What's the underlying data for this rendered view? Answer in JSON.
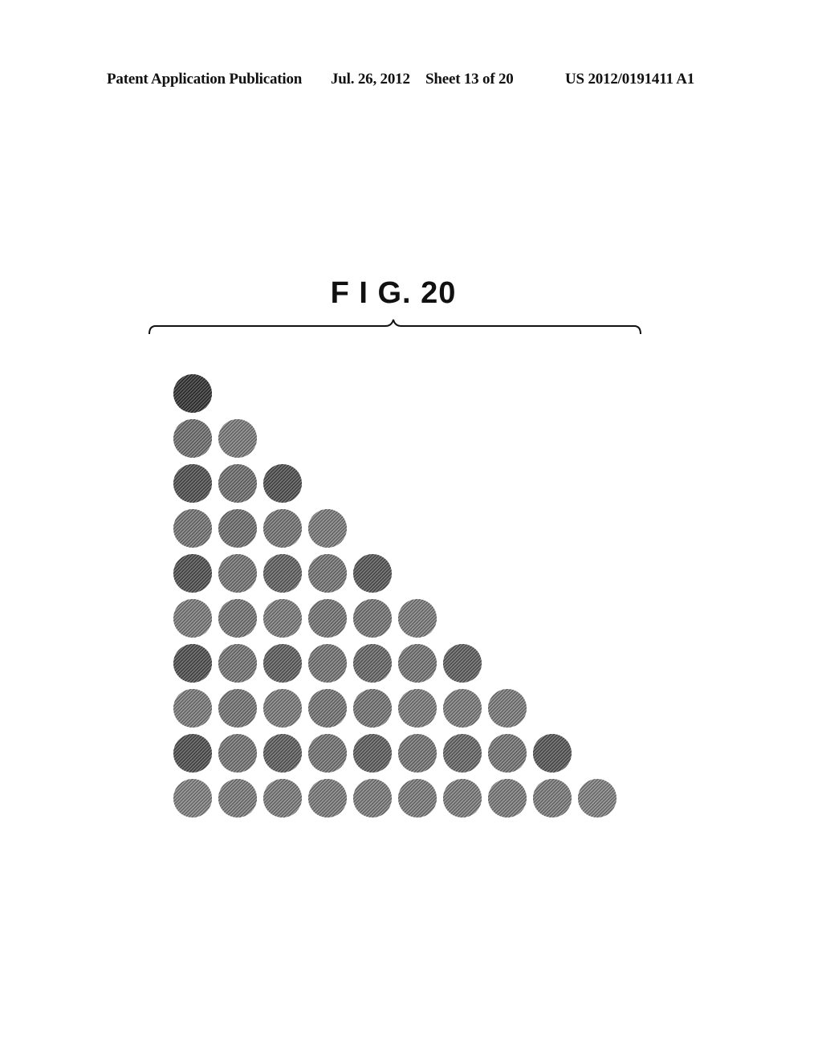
{
  "header": {
    "publication": "Patent Application Publication",
    "date": "Jul. 26, 2012",
    "sheet": "Sheet 13 of 20",
    "number": "US 2012/0191411 A1"
  },
  "figure": {
    "title": "F I G.  20",
    "description": "Triangular array of halftone-shaded circular patterns; row n contains n circles",
    "rows": [
      {
        "row": 1,
        "shades": [
          0.8
        ]
      },
      {
        "row": 2,
        "shades": [
          0.55,
          0.5
        ]
      },
      {
        "row": 3,
        "shades": [
          0.68,
          0.55,
          0.68
        ]
      },
      {
        "row": 4,
        "shades": [
          0.52,
          0.55,
          0.52,
          0.5
        ]
      },
      {
        "row": 5,
        "shades": [
          0.68,
          0.52,
          0.6,
          0.52,
          0.65
        ]
      },
      {
        "row": 6,
        "shades": [
          0.5,
          0.52,
          0.5,
          0.52,
          0.52,
          0.5
        ]
      },
      {
        "row": 7,
        "shades": [
          0.68,
          0.52,
          0.62,
          0.52,
          0.58,
          0.52,
          0.62
        ]
      },
      {
        "row": 8,
        "shades": [
          0.5,
          0.52,
          0.5,
          0.52,
          0.52,
          0.5,
          0.5,
          0.5
        ]
      },
      {
        "row": 9,
        "shades": [
          0.68,
          0.52,
          0.62,
          0.52,
          0.62,
          0.52,
          0.58,
          0.52,
          0.65
        ]
      },
      {
        "row": 10,
        "shades": [
          0.48,
          0.5,
          0.5,
          0.5,
          0.5,
          0.5,
          0.5,
          0.5,
          0.5,
          0.48
        ]
      }
    ]
  },
  "colors": {
    "ink": "#111111",
    "background": "#ffffff"
  }
}
